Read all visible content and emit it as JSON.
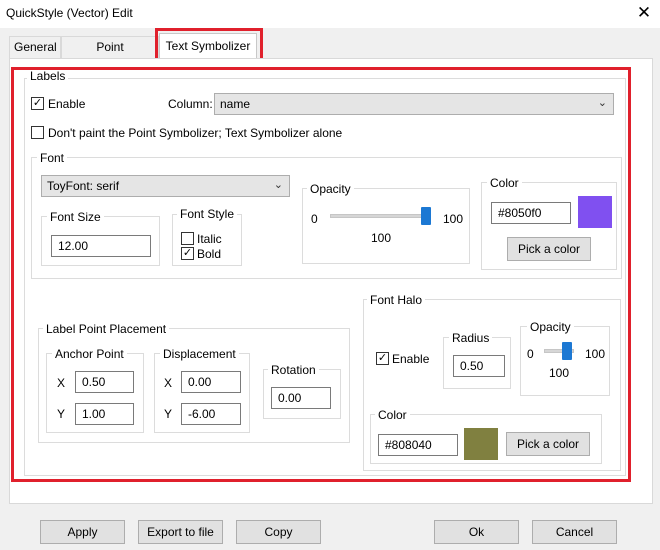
{
  "window": {
    "title": "QuickStyle (Vector) Edit"
  },
  "tabs": [
    {
      "label": "General"
    },
    {
      "label": "Point Symbolizer"
    },
    {
      "label": "Text Symbolizer"
    }
  ],
  "labels": {
    "group_title": "Labels",
    "enable_label": "Enable",
    "enable_checked": true,
    "column_label": "Column:",
    "column_value": "name",
    "dont_paint_label": "Don't paint the Point Symbolizer; Text Symbolizer alone",
    "dont_paint_checked": false
  },
  "font": {
    "group_title": "Font",
    "family_value": "ToyFont: serif",
    "size_title": "Font Size",
    "size_value": "12.00",
    "style_title": "Font Style",
    "italic_label": "Italic",
    "italic_checked": false,
    "bold_label": "Bold",
    "bold_checked": true,
    "opacity_title": "Opacity",
    "opacity_min": "0",
    "opacity_max": "100",
    "opacity_value": "100",
    "color_title": "Color",
    "color_hex": "#8050f0",
    "color_swatch": "#8050f0",
    "pick_label": "Pick a color"
  },
  "placement": {
    "group_title": "Label Point Placement",
    "anchor_title": "Anchor Point",
    "anchor_x_label": "X",
    "anchor_x": "0.50",
    "anchor_y_label": "Y",
    "anchor_y": "1.00",
    "disp_title": "Displacement",
    "disp_x_label": "X",
    "disp_x": "0.00",
    "disp_y_label": "Y",
    "disp_y": "-6.00",
    "rotation_title": "Rotation",
    "rotation": "0.00"
  },
  "halo": {
    "group_title": "Font Halo",
    "enable_label": "Enable",
    "enable_checked": true,
    "radius_title": "Radius",
    "radius_value": "0.50",
    "opacity_title": "Opacity",
    "opacity_min": "0",
    "opacity_max": "100",
    "opacity_value": "100",
    "color_title": "Color",
    "color_hex": "#808040",
    "color_swatch": "#808040",
    "pick_label": "Pick a color"
  },
  "footer": {
    "apply": "Apply",
    "export": "Export to file",
    "copy": "Copy",
    "ok": "Ok",
    "cancel": "Cancel"
  },
  "icons": {
    "close": "close-icon",
    "check": "checkmark-icon",
    "dropdown": "chevron-down-icon"
  }
}
